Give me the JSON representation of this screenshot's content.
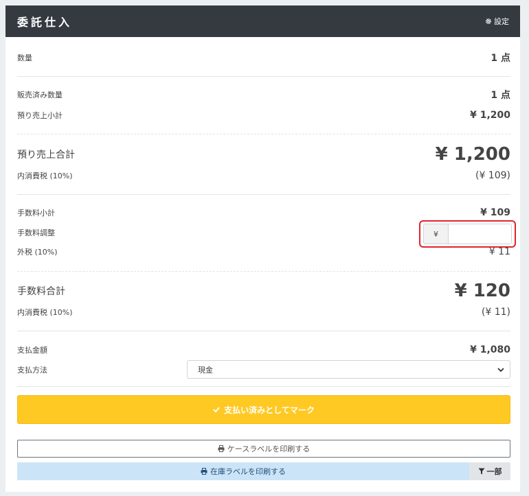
{
  "header": {
    "title": "委託仕入",
    "settings_label": "設定"
  },
  "quantity": {
    "label": "数量",
    "value": "1 点"
  },
  "sold_quantity": {
    "label": "販売済み数量",
    "value": "1 点"
  },
  "deposit_subtotal": {
    "label": "預り売上小計",
    "value": "¥ 1,200"
  },
  "deposit_total": {
    "label": "預り売上合計",
    "value": "¥ 1,200",
    "tax_label": "内消費税 (10%)",
    "tax_value": "(¥ 109)"
  },
  "fee_subtotal": {
    "label": "手数料小計",
    "value": "¥ 109"
  },
  "fee_adjust": {
    "label": "手数料調整",
    "prefix": "¥",
    "value": ""
  },
  "outer_tax": {
    "label": "外税 (10%)",
    "value": "¥ 11"
  },
  "fee_total": {
    "label": "手数料合計",
    "value": "¥ 120",
    "tax_label": "内消費税 (10%)",
    "tax_value": "(¥ 11)"
  },
  "payment_amount": {
    "label": "支払金額",
    "value": "¥ 1,080"
  },
  "payment_method": {
    "label": "支払方法",
    "selected": "現金"
  },
  "buttons": {
    "mark_paid": "支払い済みとしてマーク",
    "print_case_label": "ケースラベルを印刷する",
    "print_stock_label": "在庫ラベルを印刷する",
    "partial": "一部"
  },
  "colors": {
    "header_bg": "#343a40",
    "accent_yellow": "#ffc924",
    "highlight_red": "#e1222e",
    "stock_btn_bg": "#cce4f7"
  }
}
